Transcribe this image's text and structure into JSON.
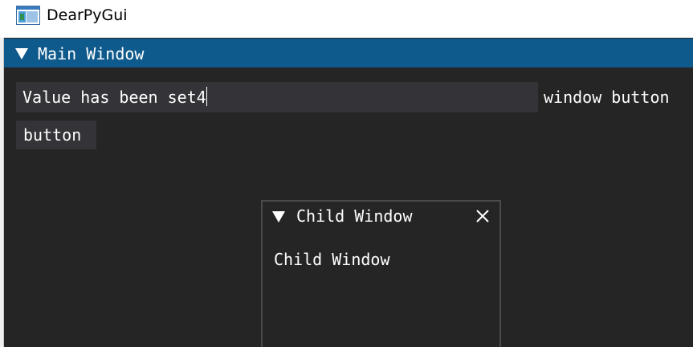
{
  "app": {
    "title": "DearPyGui",
    "icon": "app-window-icon"
  },
  "main_window": {
    "title": "Main Window",
    "collapse_icon": "triangle-down-icon",
    "input": {
      "value": "Value has been set4"
    },
    "window_button_label": "window button",
    "button_label": "button"
  },
  "child_window": {
    "title": "Child Window",
    "collapse_icon": "triangle-down-icon",
    "close_icon": "close-icon",
    "content_text": "Child Window"
  },
  "colors": {
    "header_blue": "#0f5a8c",
    "background": "#252525",
    "widget_bg": "#333338",
    "text": "#ffffff"
  }
}
